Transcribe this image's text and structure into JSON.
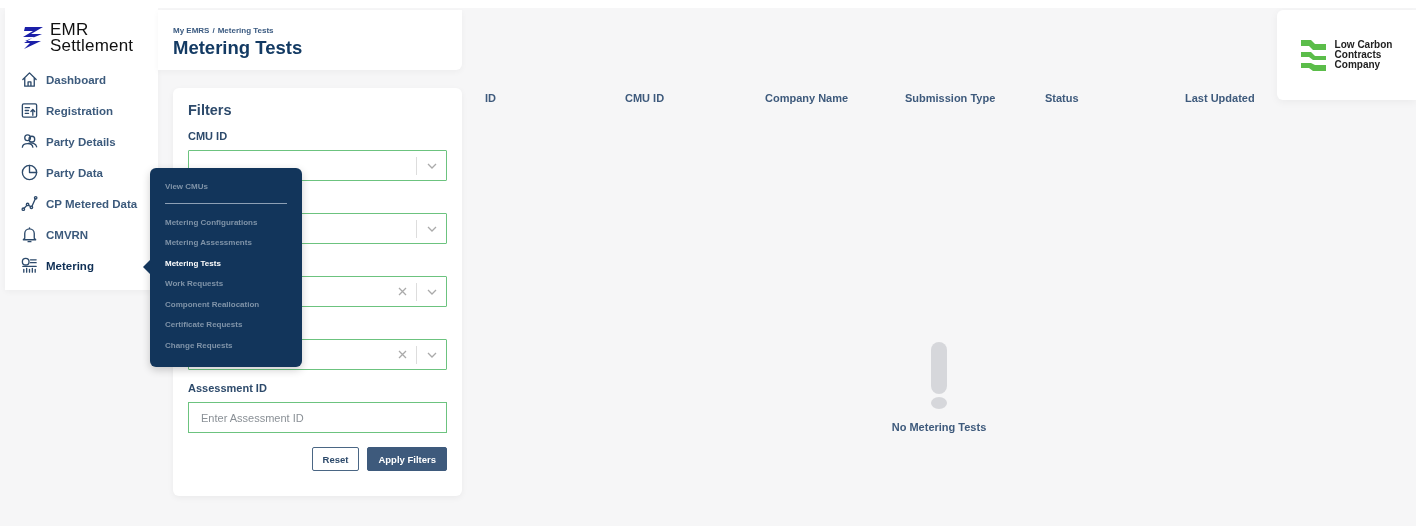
{
  "brand": {
    "lines": [
      "EMR",
      "Settlement"
    ]
  },
  "sidebar": {
    "items": [
      {
        "label": "Dashboard",
        "selected": false
      },
      {
        "label": "Registration",
        "selected": false
      },
      {
        "label": "Party Details",
        "selected": false
      },
      {
        "label": "Party Data",
        "selected": false
      },
      {
        "label": "CP Metered Data",
        "selected": false
      },
      {
        "label": "CMVRN",
        "selected": false
      },
      {
        "label": "Metering",
        "selected": true
      }
    ]
  },
  "header": {
    "breadcrumb": [
      "My EMRS",
      "Metering Tests"
    ],
    "separator": "/",
    "title": "Metering Tests"
  },
  "flyout": {
    "items": [
      {
        "kind": "link",
        "label": "View CMUs",
        "selected": false
      },
      {
        "kind": "divider"
      },
      {
        "kind": "link",
        "label": "Metering Configurations",
        "selected": false
      },
      {
        "kind": "link",
        "label": "Metering Assessments",
        "selected": false
      },
      {
        "kind": "link",
        "label": "Metering Tests",
        "selected": true
      },
      {
        "kind": "link",
        "label": "Work Requests",
        "selected": false
      },
      {
        "kind": "link",
        "label": "Component Reallocation",
        "selected": false
      },
      {
        "kind": "link",
        "label": "Certificate Requests",
        "selected": false
      },
      {
        "kind": "link",
        "label": "Change Requests",
        "selected": false
      }
    ]
  },
  "filters": {
    "title": "Filters",
    "fields": [
      {
        "kind": "select",
        "label": "CMU ID",
        "clearable": false
      },
      {
        "kind": "select",
        "clearable": false
      },
      {
        "kind": "select",
        "clearable": true
      },
      {
        "kind": "select",
        "clearable": true
      },
      {
        "kind": "text",
        "label": "Assessment ID",
        "placeholder": "Enter Assessment ID"
      }
    ],
    "buttons": [
      {
        "kind": "secondary",
        "label": "Reset"
      },
      {
        "kind": "primary",
        "label": "Apply Filters"
      }
    ]
  },
  "table": {
    "columns": [
      "ID",
      "CMU ID",
      "Company Name",
      "Submission Type",
      "Status",
      "Last Updated"
    ]
  },
  "empty_state": {
    "message": "No Metering Tests"
  },
  "partner_logo": {
    "lines": [
      "Low Carbon",
      "Contracts",
      "Company"
    ]
  }
}
